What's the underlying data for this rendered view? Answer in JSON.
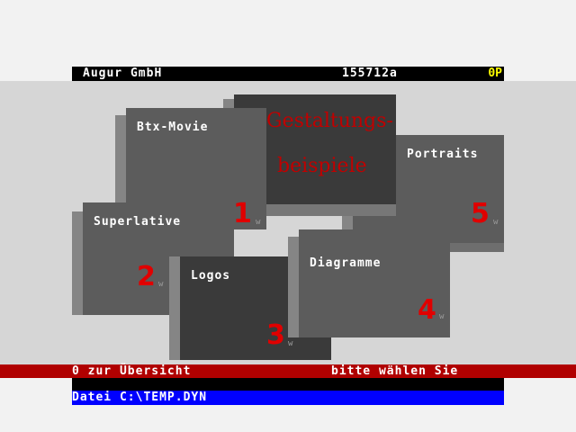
{
  "header": {
    "company": "Augur GmbH",
    "page_number": "155712a",
    "price": "0P"
  },
  "title_tile": {
    "line1": "Gestaltungs-",
    "line2": "beispiele"
  },
  "tiles": [
    {
      "label": "Btx-Movie",
      "number": "1",
      "marker": "w"
    },
    {
      "label": "Superlative",
      "number": "2",
      "marker": "w"
    },
    {
      "label": "Logos",
      "number": "3",
      "marker": "w"
    },
    {
      "label": "Diagramme",
      "number": "4",
      "marker": "w"
    },
    {
      "label": "Portraits",
      "number": "5",
      "marker": "w"
    }
  ],
  "status": {
    "left": "0 zur Übersicht",
    "right": "bitte wählen Sie"
  },
  "file": {
    "text": "Datei C:\\TEMP.DYN"
  },
  "colors": {
    "header_bg": "#000000",
    "price": "#ffff00",
    "status_bg": "#b00000",
    "file_bg": "#0000ff",
    "number": "#e00000",
    "title": "#c00000"
  }
}
